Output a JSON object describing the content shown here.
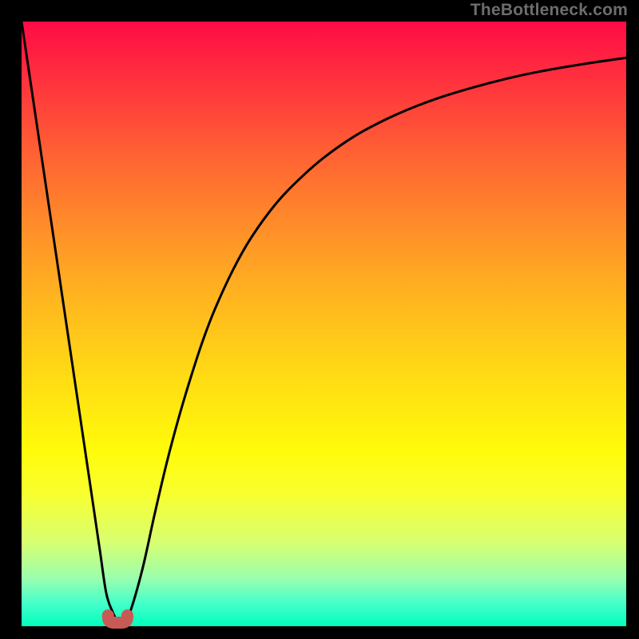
{
  "watermark": "TheBottleneck.com",
  "colors": {
    "frame": "#000000",
    "curve": "#000000",
    "marker_fill": "#c85a55",
    "marker_stroke": "#c85a55"
  },
  "chart_data": {
    "type": "line",
    "title": "",
    "xlabel": "",
    "ylabel": "",
    "xlim": [
      0,
      100
    ],
    "ylim": [
      0,
      100
    ],
    "grid": false,
    "legend": false,
    "x": [
      0,
      2,
      4,
      6,
      8,
      10,
      12,
      13,
      14,
      15,
      16,
      17,
      18,
      20,
      22,
      24,
      26,
      28,
      30,
      32,
      35,
      38,
      42,
      46,
      50,
      55,
      60,
      65,
      70,
      75,
      80,
      85,
      90,
      95,
      100
    ],
    "values": [
      100,
      86.5,
      73,
      59.5,
      46,
      32.5,
      19,
      12.2,
      5.5,
      2.5,
      0.7,
      0.7,
      2.5,
      9.5,
      18.5,
      27,
      34.5,
      41.2,
      47.3,
      52.5,
      59,
      64.3,
      69.8,
      74,
      77.5,
      81,
      83.7,
      85.9,
      87.7,
      89.2,
      90.5,
      91.6,
      92.5,
      93.3,
      94
    ],
    "annotations": [
      {
        "type": "marker",
        "shape": "u",
        "x_range": [
          14.3,
          17.5
        ],
        "y": 0.6,
        "color": "#c85a55"
      }
    ]
  }
}
